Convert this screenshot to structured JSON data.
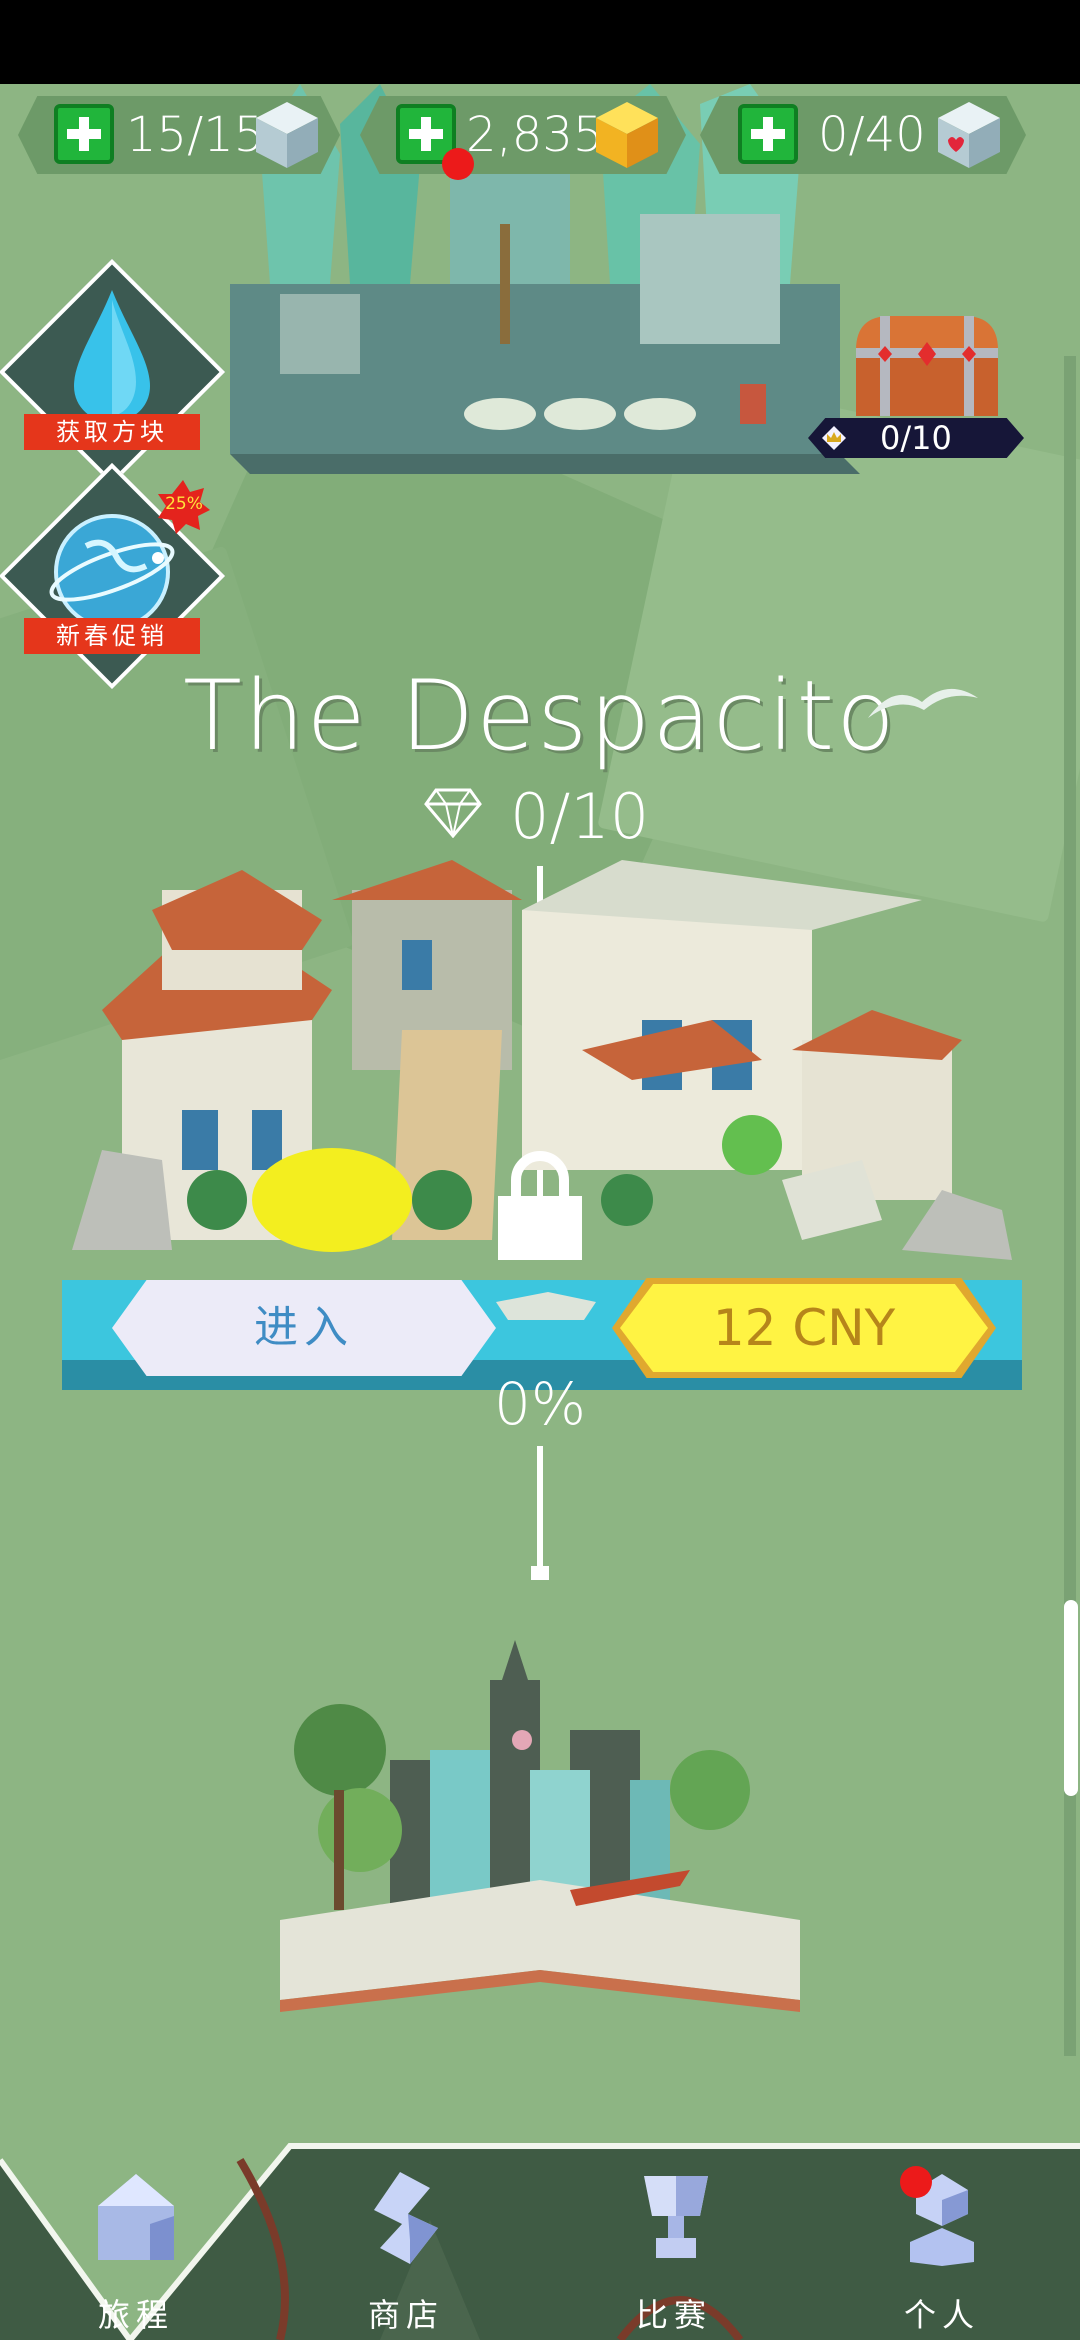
{
  "resources": {
    "energy": {
      "value": "15/15",
      "icon": "ice-cube-icon"
    },
    "coins": {
      "value": "2,835",
      "icon": "gold-cube-icon"
    },
    "hearts": {
      "value": "0/40",
      "icon": "heart-cube-icon"
    }
  },
  "chest": {
    "progress": "0/10",
    "icon": "treasure-chest-icon"
  },
  "side_buttons": [
    {
      "label": "获取方块",
      "icon": "water-drop-icon"
    },
    {
      "label": "新春促销",
      "icon": "globe-icon",
      "badge": "25%"
    }
  ],
  "level": {
    "title": "The Despacito",
    "gems": "0/10",
    "enter_label": "进入",
    "buy_label": "12 CNY",
    "progress": "0%"
  },
  "nav": [
    {
      "label": "旅程",
      "icon": "home-icon",
      "active": true
    },
    {
      "label": "商店",
      "icon": "shop-icon",
      "active": false
    },
    {
      "label": "比赛",
      "icon": "trophy-icon",
      "active": false
    },
    {
      "label": "个人",
      "icon": "person-icon",
      "active": false,
      "notification": true
    }
  ],
  "colors": {
    "background": "#8db583",
    "plus_green": "#21b53b",
    "buy_yellow": "#fff343",
    "badge_red": "#e5361b",
    "nav_bg": "#3f5b44"
  }
}
